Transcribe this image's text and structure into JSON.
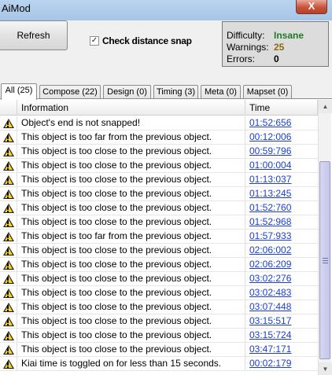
{
  "window": {
    "title": "AiMod",
    "close_label": "X"
  },
  "toolbar": {
    "refresh_label": "Refresh",
    "snap_label": "Check distance snap",
    "snap_checked": "✓"
  },
  "stats": {
    "difficulty_label": "Difficulty:",
    "difficulty_value": "Insane",
    "difficulty_color": "#1e7c1e",
    "warnings_label": "Warnings:",
    "warnings_value": "25",
    "warnings_color": "#8a6a12",
    "errors_label": "Errors:",
    "errors_value": "0"
  },
  "tabs": [
    {
      "label": "All (25)",
      "active": true
    },
    {
      "label": "Compose (22)"
    },
    {
      "label": "Design (0)"
    },
    {
      "label": "Timing (3)"
    },
    {
      "label": "Meta (0)"
    },
    {
      "label": "Mapset (0)"
    }
  ],
  "grid": {
    "columns": [
      "Information",
      "Time"
    ],
    "rows": [
      {
        "icon": "warning-icon",
        "info": "Object's end is not snapped!",
        "time": "01:52:656"
      },
      {
        "icon": "warning-icon",
        "info": "This object is too far from the previous object.",
        "time": "00:12:006"
      },
      {
        "icon": "warning-icon",
        "info": "This object is too close to the previous object.",
        "time": "00:59:796"
      },
      {
        "icon": "warning-icon",
        "info": "This object is too close to the previous object.",
        "time": "01:00:004"
      },
      {
        "icon": "warning-icon",
        "info": "This object is too close to the previous object.",
        "time": "01:13:037"
      },
      {
        "icon": "warning-icon",
        "info": "This object is too close to the previous object.",
        "time": "01:13:245"
      },
      {
        "icon": "warning-icon",
        "info": "This object is too close to the previous object.",
        "time": "01:52:760"
      },
      {
        "icon": "warning-icon",
        "info": "This object is too close to the previous object.",
        "time": "01:52:968"
      },
      {
        "icon": "warning-icon",
        "info": "This object is too far from the previous object.",
        "time": "01:57:933"
      },
      {
        "icon": "warning-icon",
        "info": "This object is too close to the previous object.",
        "time": "02:06:002"
      },
      {
        "icon": "warning-icon",
        "info": "This object is too close to the previous object.",
        "time": "02:06:209"
      },
      {
        "icon": "warning-icon",
        "info": "This object is too close to the previous object.",
        "time": "03:02:276"
      },
      {
        "icon": "warning-icon",
        "info": "This object is too close to the previous object.",
        "time": "03:02:483"
      },
      {
        "icon": "warning-icon",
        "info": "This object is too close to the previous object.",
        "time": "03:07:448"
      },
      {
        "icon": "warning-icon",
        "info": "This object is too close to the previous object.",
        "time": "03:15:517"
      },
      {
        "icon": "warning-icon",
        "info": "This object is too close to the previous object.",
        "time": "03:15:724"
      },
      {
        "icon": "warning-icon",
        "info": "This object is too close to the previous object.",
        "time": "03:47:171"
      },
      {
        "icon": "warning-icon",
        "info": "Kiai time is toggled on for less than 15 seconds.",
        "time": "00:02:179"
      }
    ]
  }
}
